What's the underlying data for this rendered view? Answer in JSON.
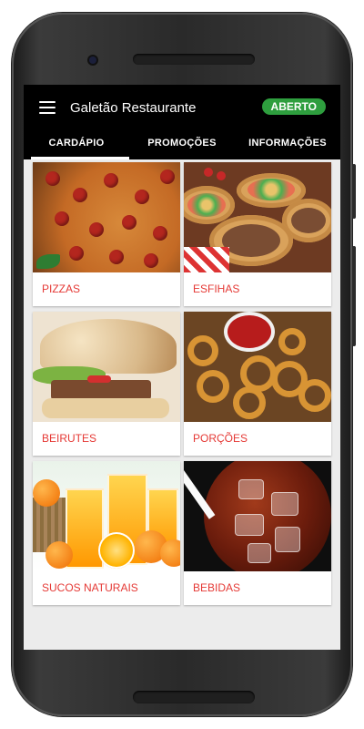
{
  "app": {
    "title": "Galetão Restaurante",
    "status": "ABERTO"
  },
  "tabs": [
    {
      "label": "CARDÁPIO",
      "active": true
    },
    {
      "label": "PROMOÇÕES",
      "active": false
    },
    {
      "label": "INFORMAÇÕES",
      "active": false
    }
  ],
  "categories": [
    {
      "label": "PIZZAS"
    },
    {
      "label": "ESFIHAS"
    },
    {
      "label": "BEIRUTES"
    },
    {
      "label": "PORÇÕES"
    },
    {
      "label": "SUCOS NATURAIS"
    },
    {
      "label": "BEBIDAS"
    }
  ],
  "colors": {
    "appbar": "#000000",
    "status_badge": "#2e9e3e",
    "category_label": "#e53935"
  }
}
